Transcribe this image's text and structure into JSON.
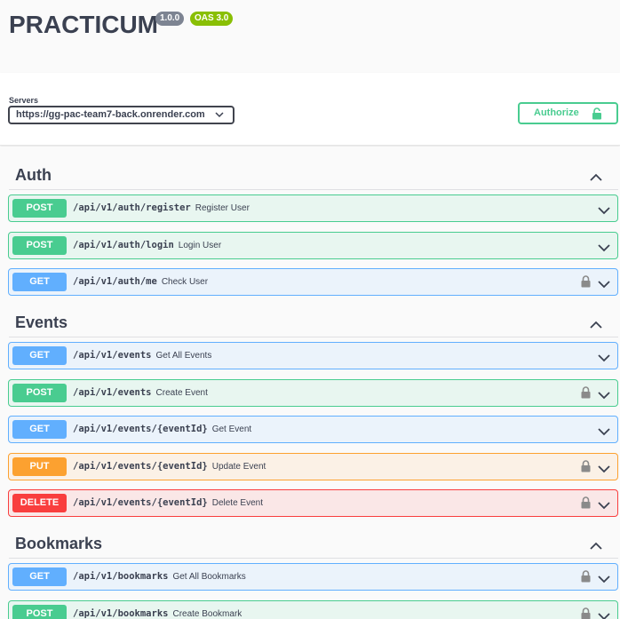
{
  "info": {
    "title": "PRACTICUM",
    "version": "1.0.0",
    "oas": "OAS 3.0"
  },
  "servers": {
    "label": "Servers",
    "selected": "https://gg-pac-team7-back.onrender.com"
  },
  "authorize": {
    "label": "Authorize"
  },
  "tags": [
    {
      "name": "Auth",
      "operations": [
        {
          "method": "POST",
          "path": "/api/v1/auth/register",
          "summary": "Register User",
          "locked": false
        },
        {
          "method": "POST",
          "path": "/api/v1/auth/login",
          "summary": "Login User",
          "locked": false
        },
        {
          "method": "GET",
          "path": "/api/v1/auth/me",
          "summary": "Check User",
          "locked": true
        }
      ]
    },
    {
      "name": "Events",
      "operations": [
        {
          "method": "GET",
          "path": "/api/v1/events",
          "summary": "Get All Events",
          "locked": false
        },
        {
          "method": "POST",
          "path": "/api/v1/events",
          "summary": "Create Event",
          "locked": true
        },
        {
          "method": "GET",
          "path": "/api/v1/events/{eventId}",
          "summary": "Get Event",
          "locked": false
        },
        {
          "method": "PUT",
          "path": "/api/v1/events/{eventId}",
          "summary": "Update Event",
          "locked": true
        },
        {
          "method": "DELETE",
          "path": "/api/v1/events/{eventId}",
          "summary": "Delete Event",
          "locked": true
        }
      ]
    },
    {
      "name": "Bookmarks",
      "operations": [
        {
          "method": "GET",
          "path": "/api/v1/bookmarks",
          "summary": "Get All Bookmarks",
          "locked": true
        },
        {
          "method": "POST",
          "path": "/api/v1/bookmarks",
          "summary": "Create Bookmark",
          "locked": true
        }
      ]
    }
  ],
  "colors": {
    "post": "#49cc90",
    "get": "#61affe",
    "put": "#fca130",
    "delete": "#f93e3e",
    "oas_badge": "#89bf04",
    "version_badge": "#7d8492"
  }
}
